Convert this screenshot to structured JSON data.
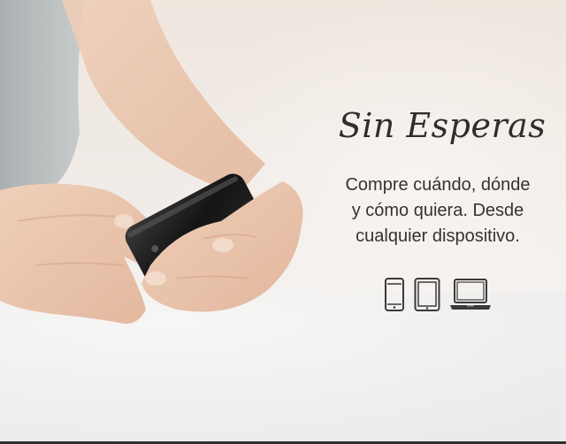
{
  "banner": {
    "title": "Sin Esperas",
    "subtitle_lines": [
      "Compre cuándo, dónde",
      "y cómo quiera. Desde",
      "cualquier dispositivo."
    ],
    "device_icons": [
      "smartphone-icon",
      "tablet-icon",
      "laptop-icon"
    ],
    "icon_color": "#3a3a3a",
    "title_color": "#2e2e2e"
  }
}
